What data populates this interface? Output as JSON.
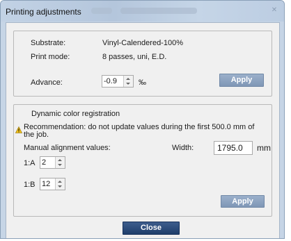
{
  "window": {
    "title": "Printing adjustments"
  },
  "settings": {
    "substrate_label": "Substrate:",
    "substrate_value": "Vinyl-Calendered-100%",
    "print_mode_label": "Print mode:",
    "print_mode_value": "8 passes, uni, E.D.",
    "advance_label": "Advance:",
    "advance_value": "-0.9",
    "advance_unit": "‰",
    "apply_label": "Apply"
  },
  "dcr": {
    "group_title": "Dynamic color registration",
    "recommendation_line1": "Recommendation: do not update values during the first 500.0 mm of",
    "recommendation_line2": "the job.",
    "manual_label": "Manual alignment values:",
    "width_label": "Width:",
    "width_value": "1795.0",
    "width_unit": "mm",
    "a_label": "1:A",
    "a_value": "2",
    "b_label": "1:B",
    "b_value": "12",
    "apply_label": "Apply"
  },
  "footer": {
    "close_label": "Close"
  },
  "colors": {
    "apply_button": "#8ea4c2",
    "close_button": "#2a4a78",
    "title_bar": "#c2d2e5"
  }
}
